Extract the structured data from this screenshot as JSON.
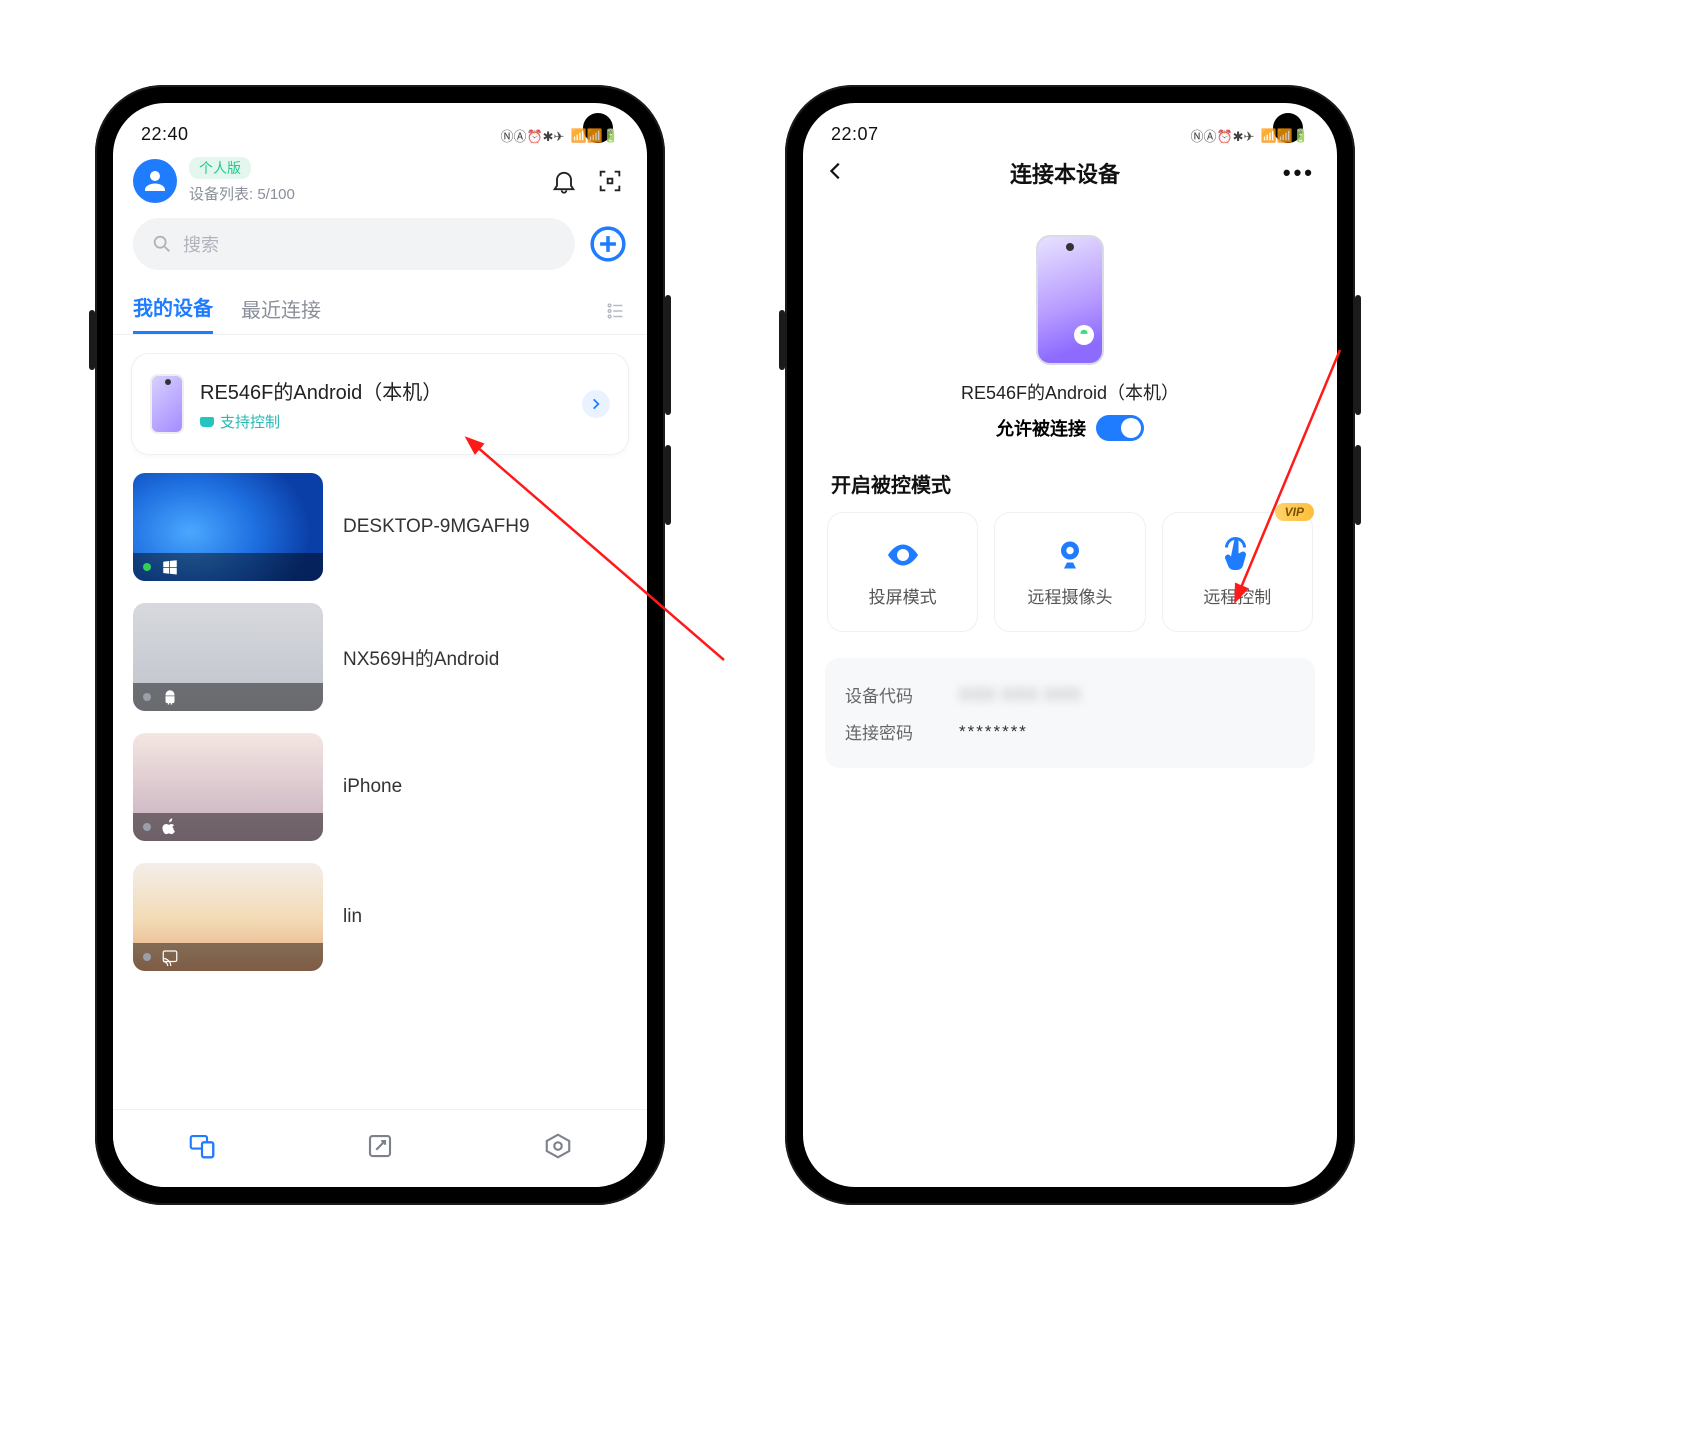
{
  "left": {
    "status_time": "22:40",
    "header": {
      "badge": "个人版",
      "device_count": "设备列表: 5/100"
    },
    "search_placeholder": "搜索",
    "tabs": {
      "devices": "我的设备",
      "recent": "最近连接"
    },
    "card": {
      "title": "RE546F的Android（本机）",
      "subtitle": "支持控制"
    },
    "list": [
      {
        "name": "DESKTOP-9MGAFH9",
        "os": "windows",
        "online": true
      },
      {
        "name": "NX569H的Android",
        "os": "android",
        "online": false
      },
      {
        "name": "iPhone",
        "os": "apple",
        "online": false
      },
      {
        "name": "lin",
        "os": "cast",
        "online": false
      }
    ]
  },
  "right": {
    "status_time": "22:07",
    "title": "连接本设备",
    "device_name": "RE546F的Android（本机）",
    "allow_label": "允许被连接",
    "allow_connect": true,
    "section_title": "开启被控模式",
    "modes": {
      "screencast": "投屏模式",
      "camera": "远程摄像头",
      "control": "远程控制",
      "control_vip": "VIP"
    },
    "info": {
      "code_label": "设备代码",
      "code_value": "XXX XXX XXX",
      "pwd_label": "连接密码",
      "pwd_value": "********"
    }
  },
  "colors": {
    "accent": "#1f7cff",
    "teal": "#25c4bf"
  }
}
